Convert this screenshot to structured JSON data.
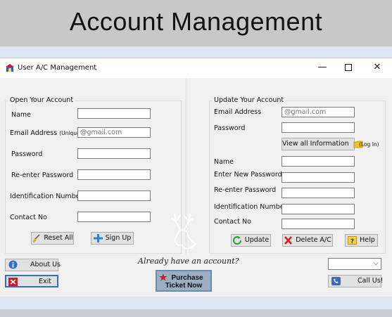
{
  "banner": {
    "title": "Account Management"
  },
  "window": {
    "title": "User A/C Management",
    "controls": {
      "minimize": "—",
      "close": "✕"
    }
  },
  "open_account": {
    "legend": "Open Your Account",
    "fields": [
      {
        "label": "Name",
        "value": ""
      },
      {
        "label": "Email Address",
        "label_suffix": "(Unique)",
        "value": "@gmail.com"
      },
      {
        "label": "Password",
        "value": ""
      },
      {
        "label": "Re-enter Password",
        "value": ""
      },
      {
        "label": "Identification Number",
        "value": ""
      },
      {
        "label": "Contact No",
        "value": ""
      }
    ],
    "reset_label": "Reset All",
    "signup_label": "Sign Up"
  },
  "update_account": {
    "legend": "Update Your Account",
    "email_label": "Email Address",
    "email_value": "@gmail.com",
    "password_label": "Password",
    "password_value": "",
    "view_info_label": "View all Information",
    "login_note": "(Log In)",
    "fields": [
      {
        "label": "Name",
        "value": ""
      },
      {
        "label": "Enter New Password",
        "value": ""
      },
      {
        "label": "Re-enter Password",
        "value": ""
      },
      {
        "label": "Identification Number",
        "value": ""
      },
      {
        "label": "Contact No",
        "value": ""
      }
    ],
    "update_label": "Update",
    "delete_label": "Delete A/C",
    "help_label": "Help"
  },
  "footer": {
    "about_label": "About Us",
    "exit_label": "Exit",
    "already_text": "Already have an account?",
    "purchase_line1": "Purchase",
    "purchase_line2": "Ticket Now",
    "call_label": "Call Us!",
    "combo_value": ""
  },
  "colors": {
    "banner_bg": "#c8c8c8",
    "band_bg": "#dfe6f2",
    "window_bg": "#f0f0f0",
    "purchase_bg": "#9aaec6"
  },
  "icons": [
    "app-icon",
    "minimize-icon",
    "maximize-icon",
    "close-icon",
    "broom-icon",
    "signup-plus-icon",
    "update-arrow-icon",
    "delete-x-icon",
    "help-question-icon",
    "folder-icon",
    "info-icon",
    "exit-icon",
    "star-icon",
    "phone-icon",
    "deer-logo-icon",
    "chevron-down-icon"
  ]
}
